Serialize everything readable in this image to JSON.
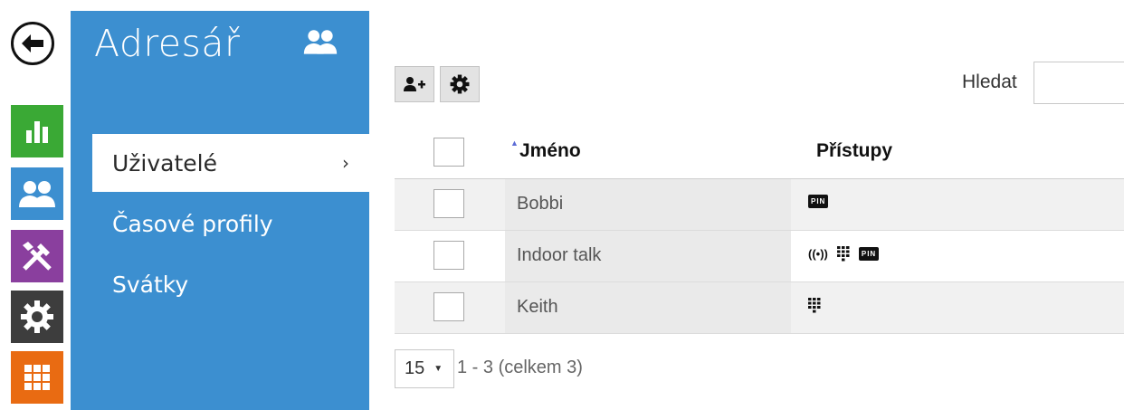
{
  "rail": {
    "tiles": [
      {
        "name": "status-tile",
        "color": "#3aa935"
      },
      {
        "name": "directory-tile",
        "color": "#3c8fd0"
      },
      {
        "name": "hardware-tile",
        "color": "#8a3f9e"
      },
      {
        "name": "system-tile",
        "color": "#3d3d3d"
      },
      {
        "name": "services-tile",
        "color": "#e96b12"
      }
    ]
  },
  "menu": {
    "title": "Adresář",
    "items": [
      {
        "label": "Uživatelé",
        "active": true
      },
      {
        "label": "Časové profily",
        "active": false
      },
      {
        "label": "Svátky",
        "active": false
      }
    ],
    "chevron": "›"
  },
  "toolbar": {
    "search_label": "Hledat",
    "search_value": ""
  },
  "table": {
    "columns": {
      "name": "Jméno",
      "access": "Přístupy"
    },
    "sort_indicator": "▲",
    "rows": [
      {
        "name": "Bobbi",
        "access": [
          "pin"
        ]
      },
      {
        "name": "Indoor talk",
        "access": [
          "rfid",
          "keypad",
          "pin"
        ]
      },
      {
        "name": "Keith",
        "access": [
          "keypad"
        ]
      }
    ],
    "pin_text": "PIN",
    "rfid_text": "((•))"
  },
  "pagination": {
    "page_size": "15",
    "info": "1 - 3 (celkem 3)"
  }
}
